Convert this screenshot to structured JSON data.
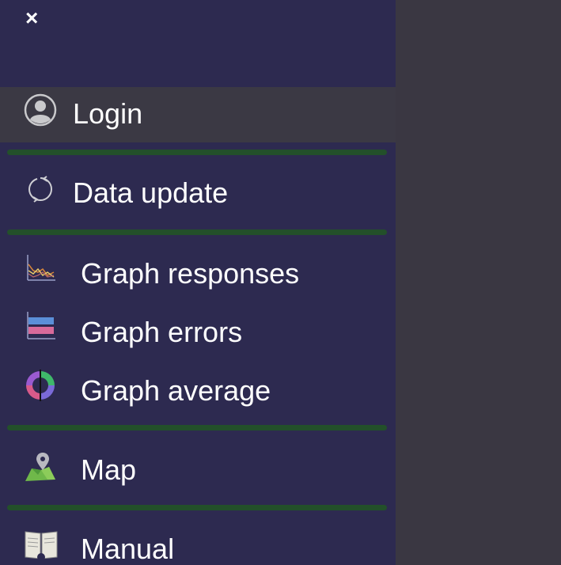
{
  "menu": {
    "close_glyph": "×",
    "items": [
      {
        "label": "Login",
        "icon": "user-circle-icon"
      },
      {
        "label": "Data update",
        "icon": "refresh-icon"
      },
      {
        "label": "Graph responses",
        "icon": "line-graph-icon"
      },
      {
        "label": "Graph errors",
        "icon": "bar-graph-icon"
      },
      {
        "label": "Graph average",
        "icon": "donut-chart-icon"
      },
      {
        "label": "Map",
        "icon": "map-pin-icon"
      },
      {
        "label": "Manual",
        "icon": "book-icon"
      }
    ]
  },
  "colors": {
    "sidebar_bg": "#2d2a50",
    "active_row_bg": "#3b3944",
    "divider": "#23502a",
    "page_bg": "#3a3742",
    "text": "#ffffff"
  }
}
